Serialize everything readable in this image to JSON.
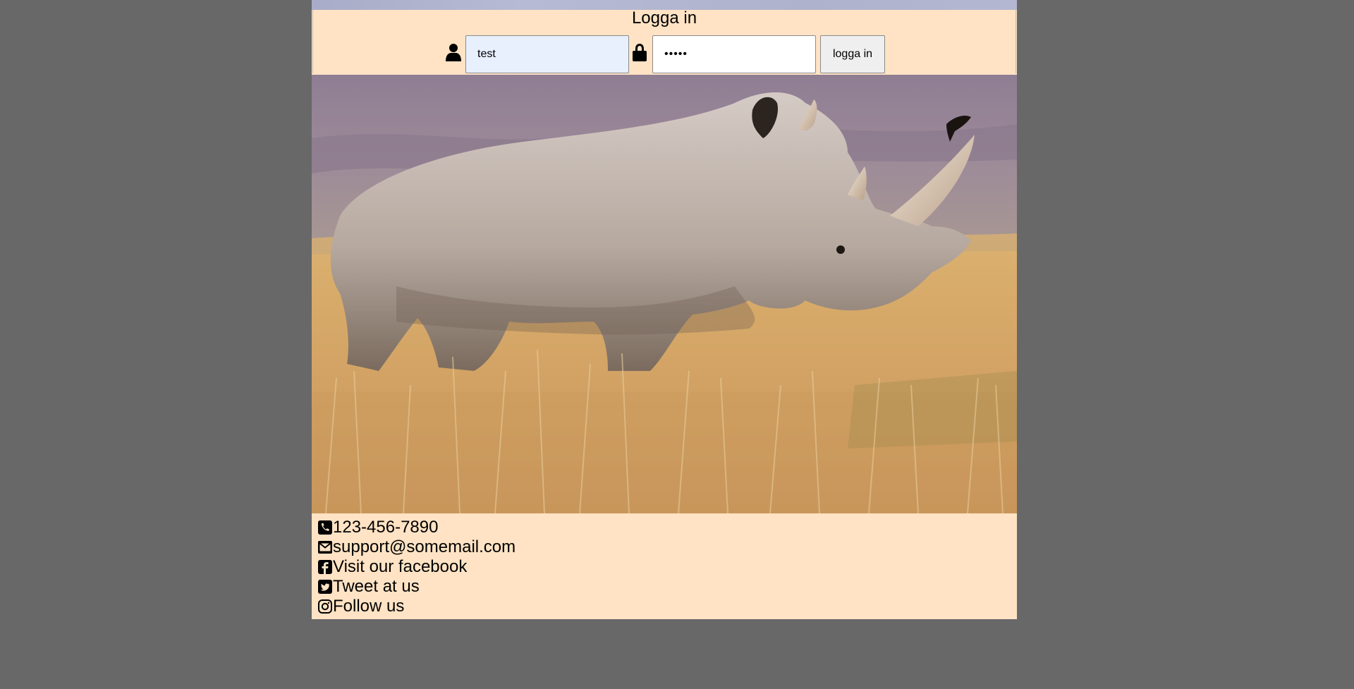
{
  "login": {
    "title": "Logga in",
    "username_value": "test",
    "password_value": "•••••",
    "button_label": "logga in"
  },
  "hero": {
    "alt": "rhino-photo"
  },
  "contact": {
    "phone": "123-456-7890",
    "email": "support@somemail.com",
    "facebook": "Visit our facebook",
    "twitter": "Tweet at us",
    "instagram": "Follow us"
  },
  "icons": {
    "user": "user-icon",
    "lock": "lock-icon",
    "phone": "phone-icon",
    "email": "envelope-icon",
    "facebook": "facebook-icon",
    "twitter": "twitter-icon",
    "instagram": "instagram-icon"
  },
  "colors": {
    "page_background": "#686868",
    "panel_background": "#ffe3c4",
    "autofill_background": "#e8f0fe",
    "button_background": "#efefef"
  }
}
